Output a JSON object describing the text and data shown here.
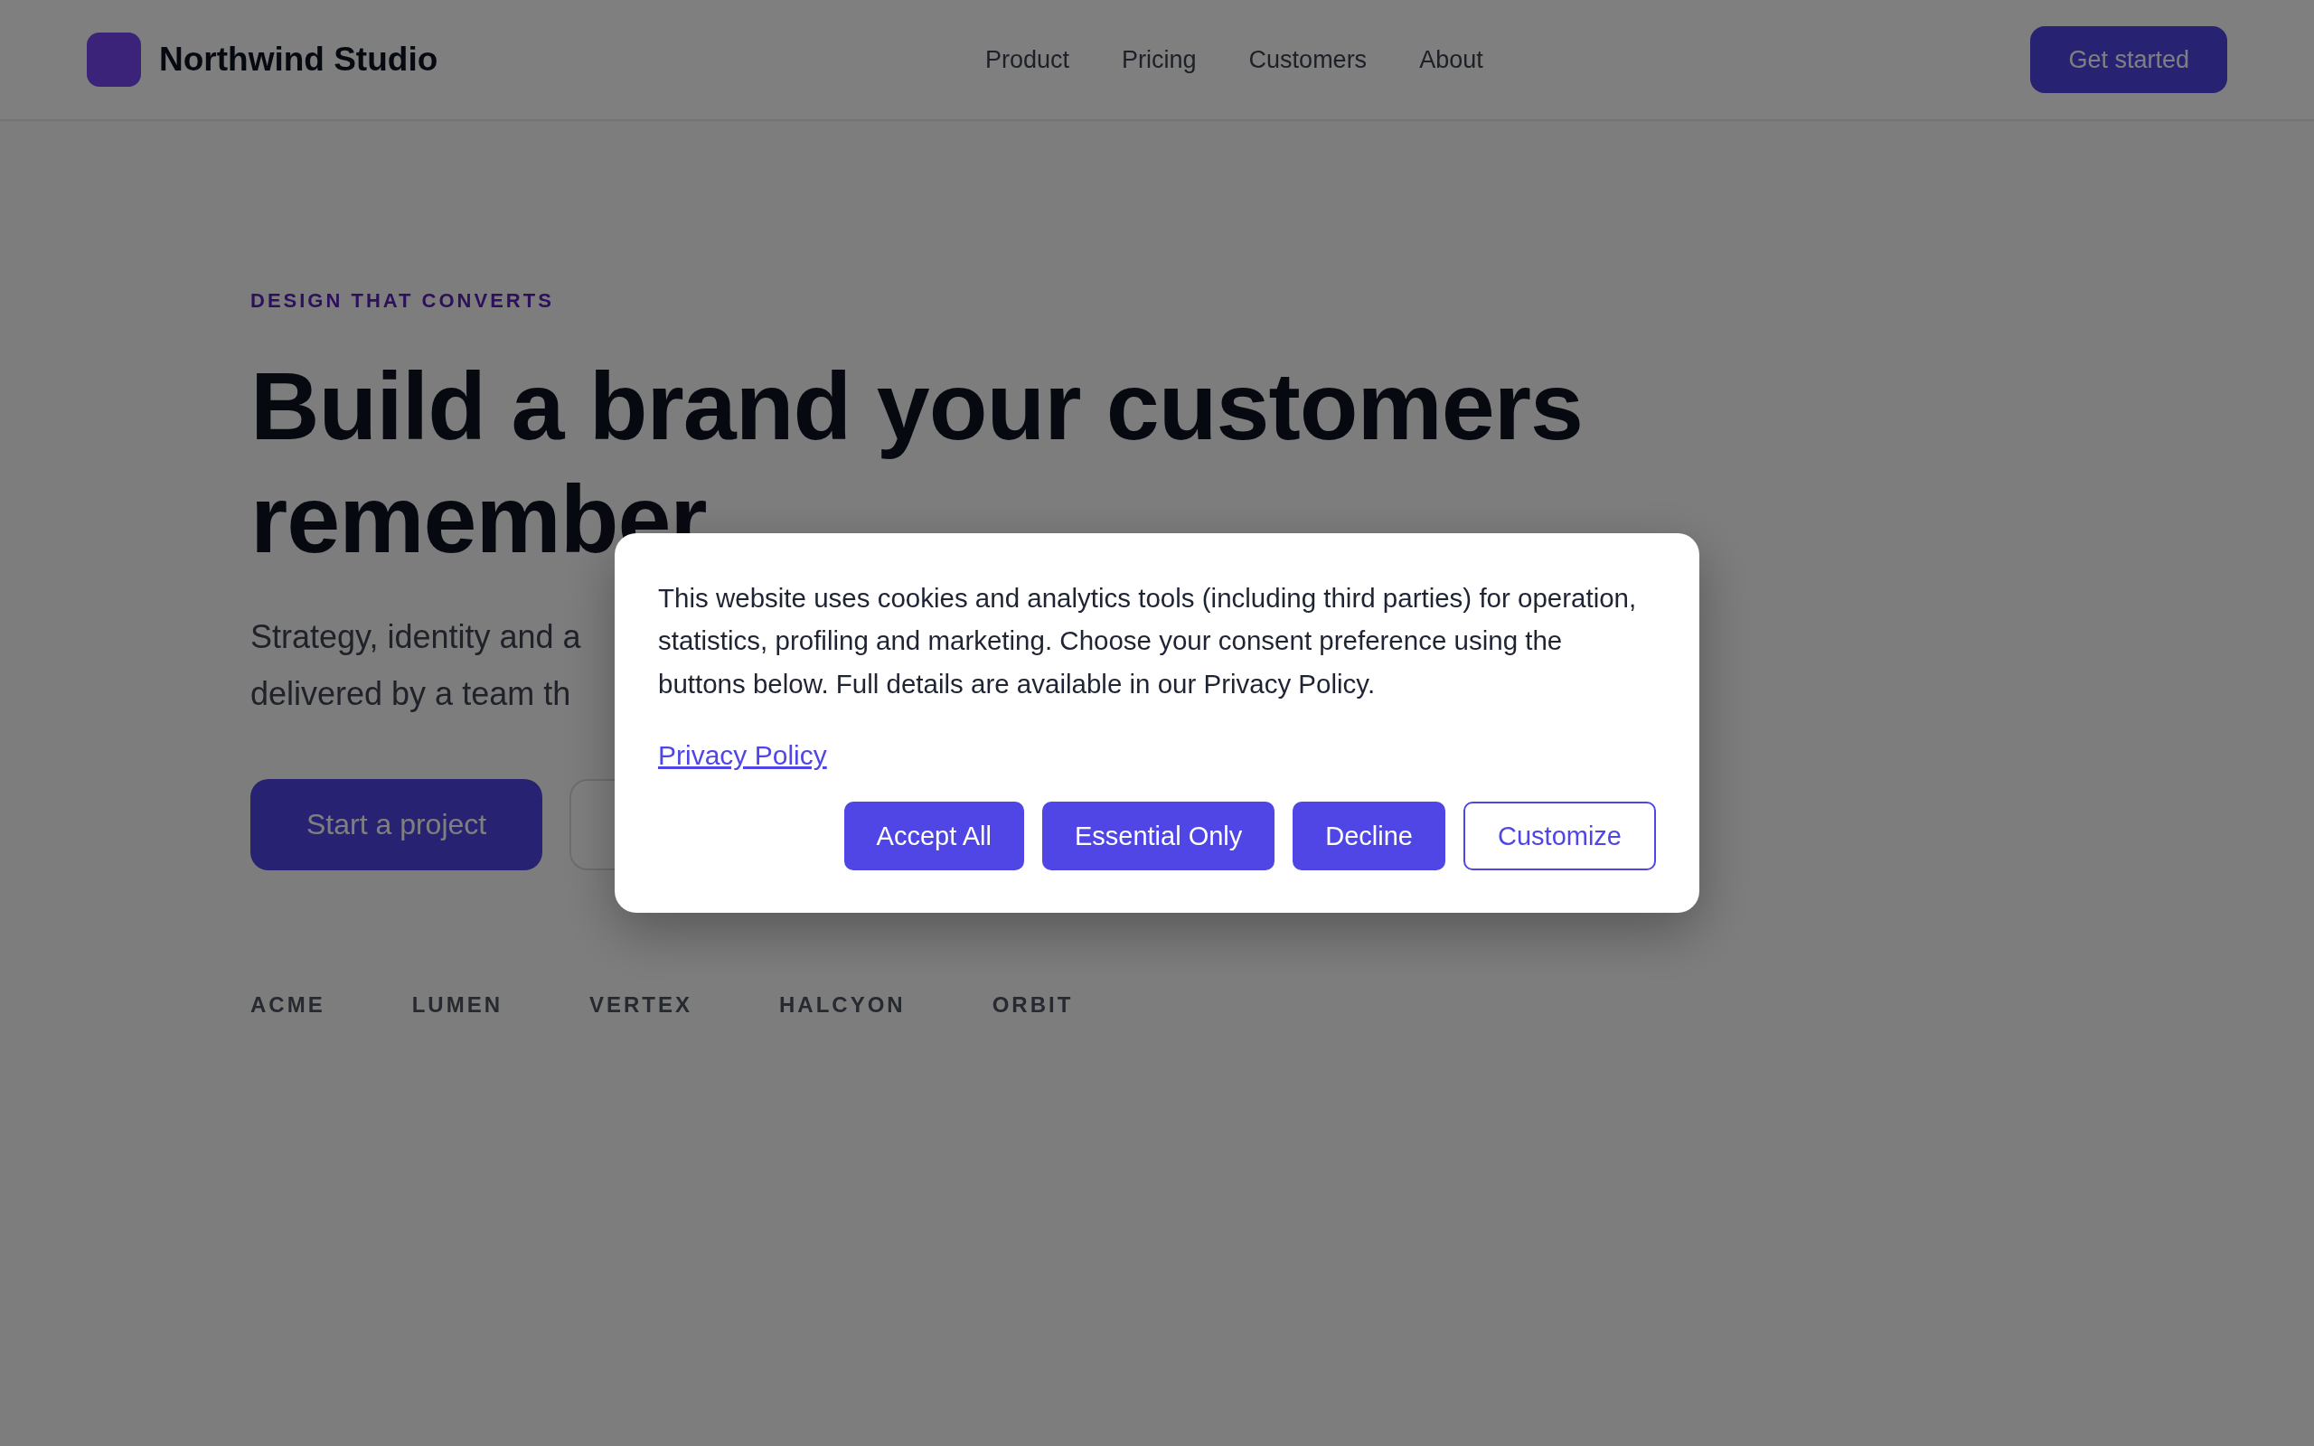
{
  "header": {
    "brand": "Northwind Studio",
    "nav": [
      {
        "label": "Product"
      },
      {
        "label": "Pricing"
      },
      {
        "label": "Customers"
      },
      {
        "label": "About"
      }
    ],
    "cta": "Get started"
  },
  "hero": {
    "eyebrow": "DESIGN THAT CONVERTS",
    "headline": "Build a brand your customers remember",
    "subtitle_lines": [
      "Strategy, identity and a",
      "delivered by a team th"
    ],
    "primary_button": "Start a project"
  },
  "logos": [
    "ACME",
    "LUMEN",
    "VERTEX",
    "HALCYON",
    "ORBIT"
  ],
  "cookie_dialog": {
    "message": "This website uses cookies and analytics tools (including third parties) for operation, statistics, profiling and marketing. Choose your consent preference using the buttons below. Full details are available in our Privacy Policy.",
    "link": "Privacy Policy",
    "buttons": [
      {
        "label": "Accept All",
        "kind": "primary"
      },
      {
        "label": "Essential Only",
        "kind": "primary"
      },
      {
        "label": "Decline",
        "kind": "primary"
      },
      {
        "label": "Customize",
        "kind": "outline"
      }
    ]
  }
}
